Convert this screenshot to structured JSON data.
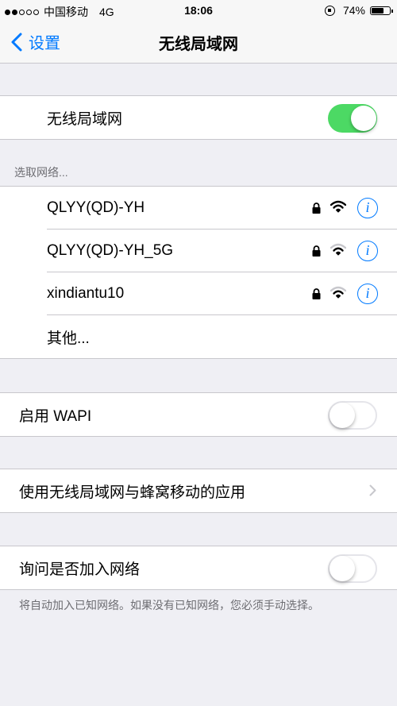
{
  "status_bar": {
    "signal_dots_filled": 2,
    "signal_dots_total": 5,
    "carrier": "中国移动",
    "network": "4G",
    "time": "18:06",
    "battery_percent": "74%",
    "battery_level": 0.74
  },
  "nav": {
    "back_label": "设置",
    "title": "无线局域网"
  },
  "wifi_toggle": {
    "label": "无线局域网",
    "on": true
  },
  "networks": {
    "header": "选取网络...",
    "items": [
      {
        "name": "QLYY(QD)-YH",
        "locked": true,
        "signal_bars": 3
      },
      {
        "name": "QLYY(QD)-YH_5G",
        "locked": true,
        "signal_bars": 2
      },
      {
        "name": "xindiantu10",
        "locked": true,
        "signal_bars": 2
      }
    ],
    "other_label": "其他...",
    "info_glyph": "i"
  },
  "wapi": {
    "label": "启用 WAPI",
    "on": false
  },
  "apps_row": {
    "label": "使用无线局域网与蜂窝移动的应用"
  },
  "ask_join": {
    "label": "询问是否加入网络",
    "on": false,
    "footer": "将自动加入已知网络。如果没有已知网络，您必须手动选择。"
  },
  "colors": {
    "accent": "#007aff",
    "switch_on": "#4cd964",
    "background": "#efeff4"
  }
}
